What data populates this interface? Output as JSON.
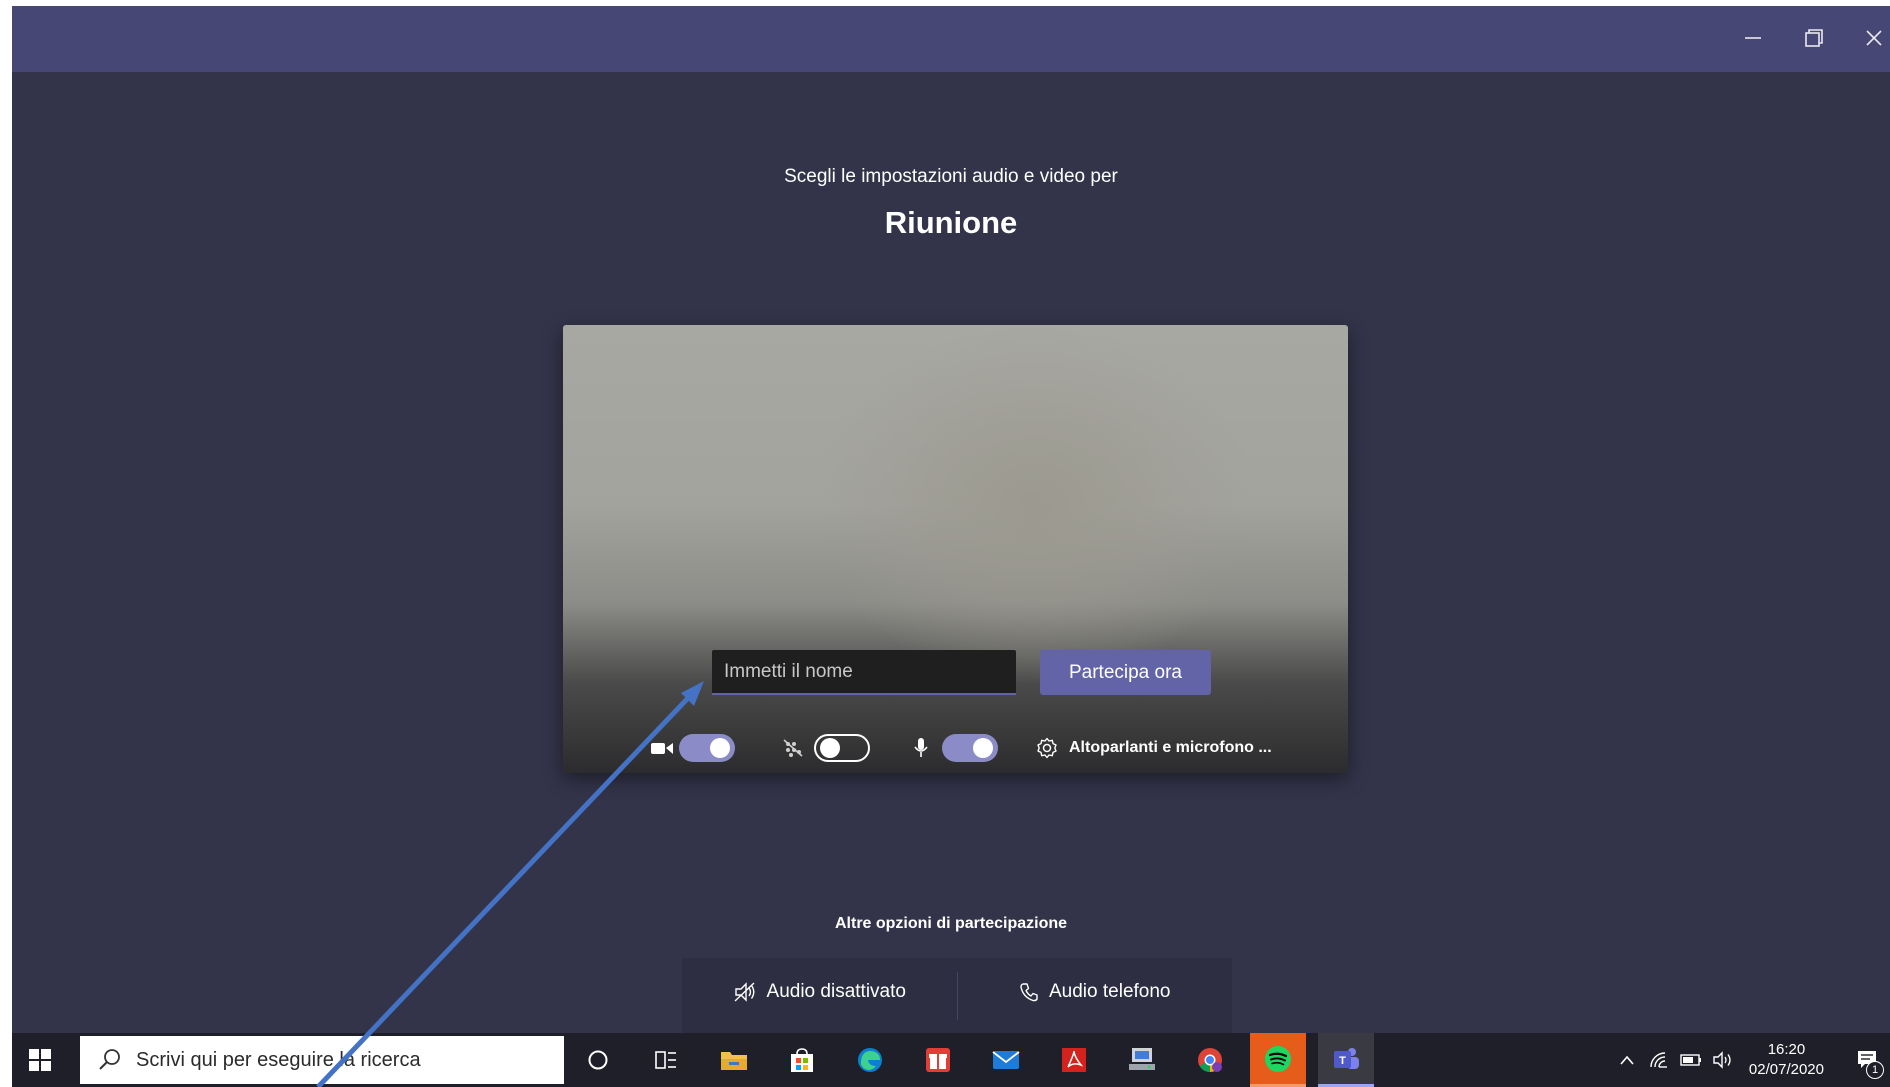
{
  "window": {
    "minimize_label": "—",
    "restore_label": "❐",
    "close_label": "✕"
  },
  "prejoin": {
    "prompt": "Scegli le impostazioni audio e video per",
    "meeting_title": "Riunione",
    "name_placeholder": "Immetti il nome",
    "join_label": "Partecipa ora",
    "camera_on": true,
    "background_blur_on": false,
    "microphone_on": true,
    "device_settings_label": "Altoparlanti e microfono ..."
  },
  "other_options": {
    "title": "Altre opzioni di partecipazione",
    "audio_off_label": "Audio disattivato",
    "phone_audio_label": "Audio telefono"
  },
  "taskbar": {
    "search_placeholder": "Scrivi qui per eseguire la ricerca",
    "time": "16:20",
    "date": "02/07/2020",
    "notification_count": "1",
    "apps": [
      "cortana-icon",
      "task-view-icon",
      "file-explorer-icon",
      "microsoft-store-icon",
      "edge-icon",
      "gift-icon",
      "mail-icon",
      "acrobat-icon",
      "network-drive-icon",
      "chrome-icon",
      "spotify-icon",
      "teams-icon"
    ]
  },
  "colors": {
    "teams_purple": "#6264a7",
    "title_bar": "#464775",
    "background": "#33344a",
    "annotation_arrow": "#4472c4"
  }
}
